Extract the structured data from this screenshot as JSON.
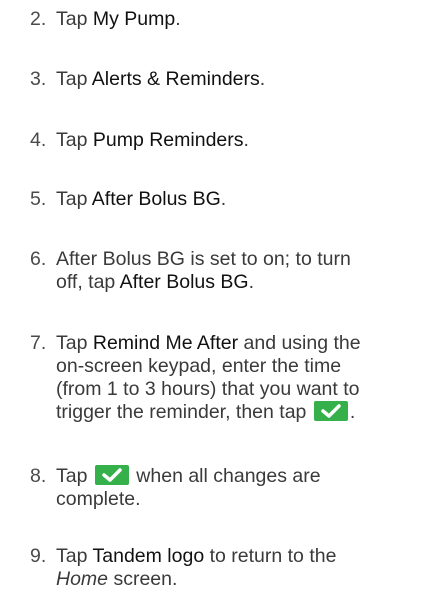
{
  "steps": [
    {
      "num": "2.",
      "pre": "Tap ",
      "target": "My Pump",
      "post": "."
    },
    {
      "num": "3.",
      "pre": "Tap ",
      "target": "Alerts & Reminders",
      "post": "."
    },
    {
      "num": "4.",
      "pre": "Tap ",
      "target": "Pump Reminders",
      "post": "."
    },
    {
      "num": "5.",
      "pre": "Tap ",
      "target": "After Bolus BG",
      "post": "."
    },
    {
      "num": "6.",
      "line1": "After Bolus BG is set to on; to turn",
      "line2_pre": "off, tap ",
      "target": "After Bolus BG",
      "post": "."
    },
    {
      "num": "7.",
      "line1_pre": "Tap ",
      "target": "Remind Me After",
      "line1_post": " and using the",
      "line2": "on-screen keypad, enter the time",
      "line3": "(from 1 to 3 hours) that you want to",
      "line4": "trigger the reminder, then tap",
      "post": "."
    },
    {
      "num": "8.",
      "pre": "Tap",
      "post": "when all changes are",
      "line2": "complete."
    },
    {
      "num": "9.",
      "pre": "Tap ",
      "target": "Tandem logo",
      "post": " to return to the",
      "line2_target": "Home",
      "line2_post": " screen."
    }
  ],
  "icons": {
    "confirm_button": "check-icon",
    "confirm_color": "#35b04a"
  }
}
